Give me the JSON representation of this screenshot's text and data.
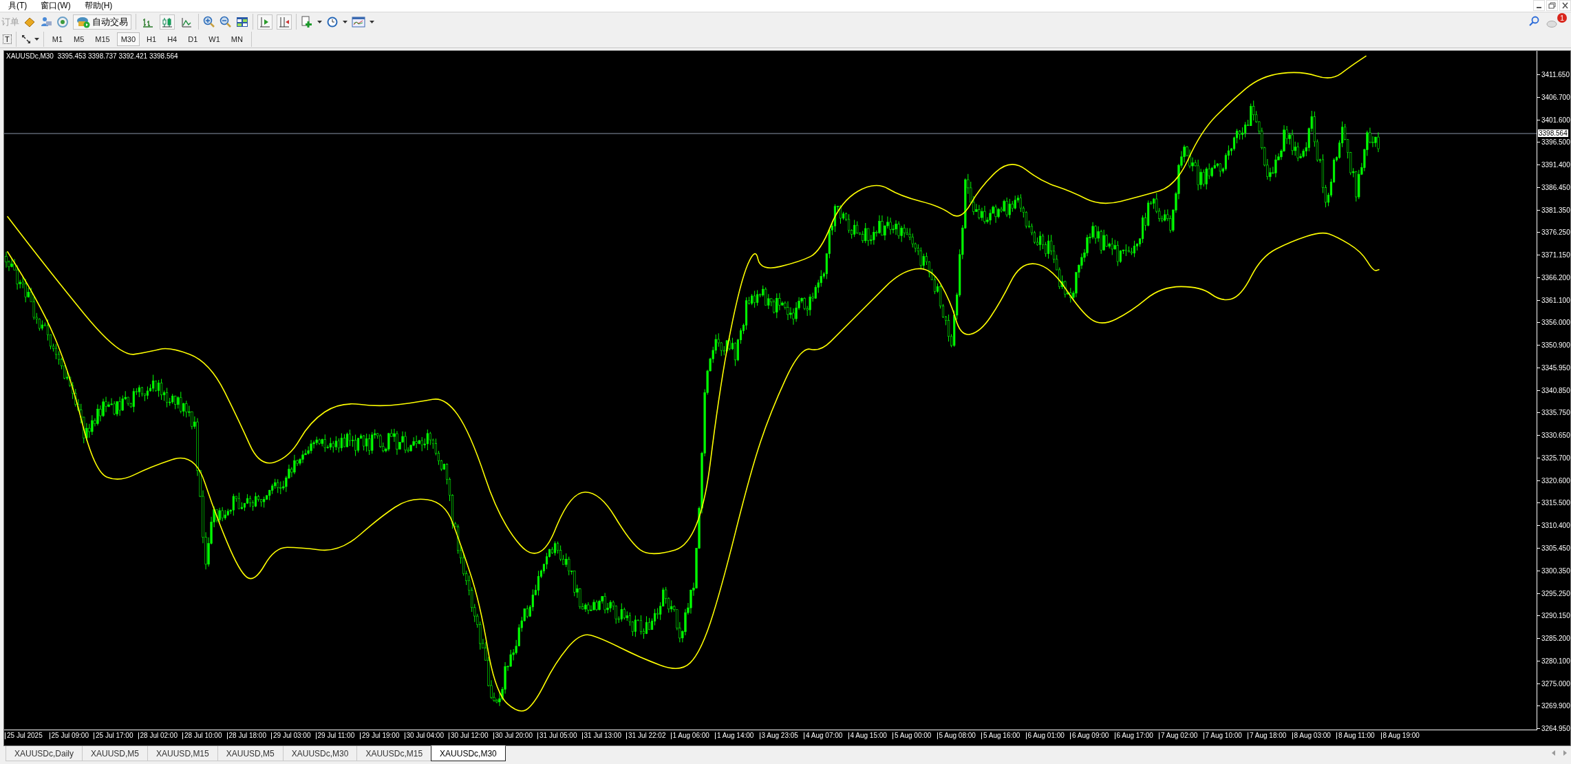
{
  "menu": [
    {
      "label": "具(T)"
    },
    {
      "label": "窗口(W)"
    },
    {
      "label": "帮助(H)"
    }
  ],
  "toolbar": {
    "new_order": {
      "label": "订单",
      "disabled": true
    },
    "auto_trading": {
      "label": "自动交易"
    },
    "chart_types": [
      {
        "selected": false
      },
      {
        "selected": true
      },
      {
        "selected": false
      }
    ],
    "auto_scroll": {
      "on": true
    },
    "chart_shift": {
      "on": true
    }
  },
  "notifications": {
    "count": "1"
  },
  "drawing_toolbar": {
    "text_tool": "T"
  },
  "timeframes": [
    {
      "label": "M1",
      "selected": false
    },
    {
      "label": "M5",
      "selected": false
    },
    {
      "label": "M15",
      "selected": false
    },
    {
      "label": "M30",
      "selected": true
    },
    {
      "label": "H1",
      "selected": false
    },
    {
      "label": "H4",
      "selected": false
    },
    {
      "label": "D1",
      "selected": false
    },
    {
      "label": "W1",
      "selected": false
    },
    {
      "label": "MN",
      "selected": false
    }
  ],
  "chart": {
    "header": "XAUUSDc,M30  3395.453 3398.737 3392.421 3398.564",
    "current_price": "3398.564",
    "price_axis": [
      "3411.650",
      "3406.700",
      "3401.600",
      "3396.500",
      "3391.400",
      "3386.450",
      "3381.350",
      "3376.250",
      "3371.150",
      "3366.200",
      "3361.100",
      "3356.000",
      "3350.900",
      "3345.950",
      "3340.850",
      "3335.750",
      "3330.650",
      "3325.700",
      "3320.600",
      "3315.500",
      "3310.400",
      "3305.450",
      "3300.350",
      "3295.250",
      "3290.150",
      "3285.200",
      "3280.100",
      "3275.000",
      "3269.900",
      "3264.950"
    ],
    "time_axis": [
      "25 Jul 2025",
      "25 Jul 09:00",
      "25 Jul 17:00",
      "28 Jul 02:00",
      "28 Jul 10:00",
      "28 Jul 18:00",
      "29 Jul 03:00",
      "29 Jul 11:00",
      "29 Jul 19:00",
      "30 Jul 04:00",
      "30 Jul 12:00",
      "30 Jul 20:00",
      "31 Jul 05:00",
      "31 Jul 13:00",
      "31 Jul 22:02",
      "1 Aug 06:00",
      "1 Aug 14:00",
      "3 Aug 23:05",
      "4 Aug 07:00",
      "4 Aug 15:00",
      "5 Aug 00:00",
      "5 Aug 08:00",
      "5 Aug 16:00",
      "6 Aug 01:00",
      "6 Aug 09:00",
      "6 Aug 17:00",
      "7 Aug 02:00",
      "7 Aug 10:00",
      "7 Aug 18:00",
      "8 Aug 03:00",
      "8 Aug 11:00",
      "8 Aug 19:00"
    ]
  },
  "tabs": [
    {
      "label": "XAUUSDc,Daily",
      "selected": false
    },
    {
      "label": "XAUUSD,M5",
      "selected": false
    },
    {
      "label": "XAUUSD,M15",
      "selected": false
    },
    {
      "label": "XAUUSD,M5",
      "selected": false
    },
    {
      "label": "XAUUSDc,M30",
      "selected": false
    },
    {
      "label": "XAUUSDc,M15",
      "selected": false
    },
    {
      "label": "XAUUSDc,M30",
      "selected": true
    }
  ]
}
